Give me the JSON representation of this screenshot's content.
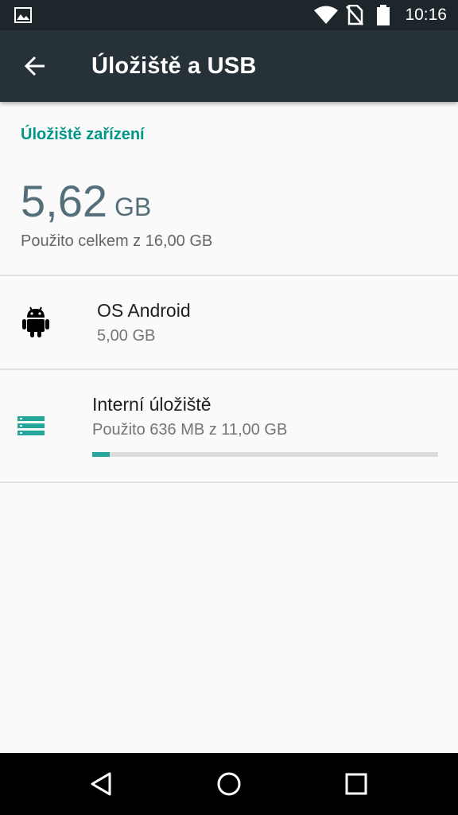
{
  "status_bar": {
    "time": "10:16",
    "icons": [
      "gallery-icon",
      "wifi-icon",
      "no-sim-icon",
      "battery-icon"
    ]
  },
  "app_bar": {
    "title": "Úložiště a USB",
    "back_icon": "arrow-back-icon"
  },
  "device_storage": {
    "section_title": "Úložiště zařízení",
    "used_value": "5,62",
    "used_unit": "GB",
    "used_caption": "Použito celkem z 16,00 GB"
  },
  "items": [
    {
      "icon": "android-icon",
      "title": "OS Android",
      "subtitle": "5,00 GB"
    },
    {
      "icon": "storage-icon",
      "title": "Interní úložiště",
      "subtitle": "Použito 636 MB z 11,00 GB",
      "progress": 0.05
    }
  ],
  "nav_bar": {
    "buttons": [
      "back-triangle-icon",
      "home-circle-icon",
      "recents-square-icon"
    ]
  },
  "colors": {
    "accent": "#009688",
    "app_bar": "#263238",
    "status_bar": "#1d262b",
    "progress": "#26a69a"
  }
}
